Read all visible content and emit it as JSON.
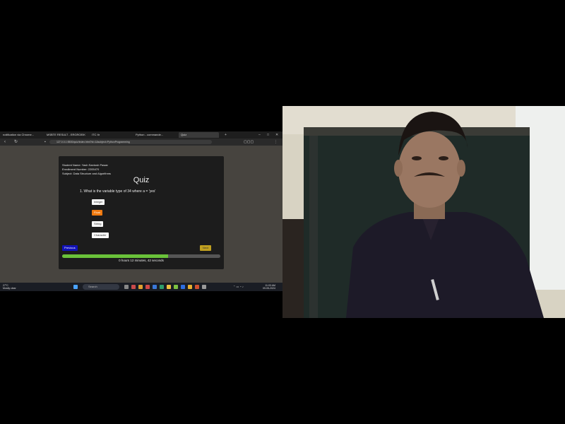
{
  "browser": {
    "tabs": [
      {
        "label": "notification via Chrome..."
      },
      {
        "label": "MSBTE RESULT - ERGROEIK"
      },
      {
        "label": "ITC Itr"
      },
      {
        "label": "Python - commande..."
      },
      {
        "label": "Quiz"
      }
    ],
    "url": "127.0.0.1:5500/quiz/index.html?id=1&subject=PythonProgramming"
  },
  "quiz": {
    "student_name": "Student Name: Yash Santosh Pawar",
    "enrollment": "Enrollment Number: 2205470",
    "subject": "Subject: Data Structure and Algorithms",
    "title": "Quiz",
    "question": "1. What is the variable type of 34 where a = 'yes'",
    "options": [
      "Integer",
      "Float",
      "String",
      "Character"
    ],
    "selected_index": 1,
    "prev_label": "Previous",
    "next_label": "Next",
    "progress": 0.67,
    "timer": "0 hours 12 minutes, 42 seconds"
  },
  "taskbar": {
    "weather_temp": "27°C",
    "weather_desc": "Mostly clear",
    "search_placeholder": "Search",
    "time": "11:03 AM",
    "date": "09-05-2024"
  },
  "colors": {
    "prev_button": "#1212b8",
    "next_button": "#c0a020",
    "selected_option": "#f07a10",
    "progress_fill": "#6ac23a"
  }
}
